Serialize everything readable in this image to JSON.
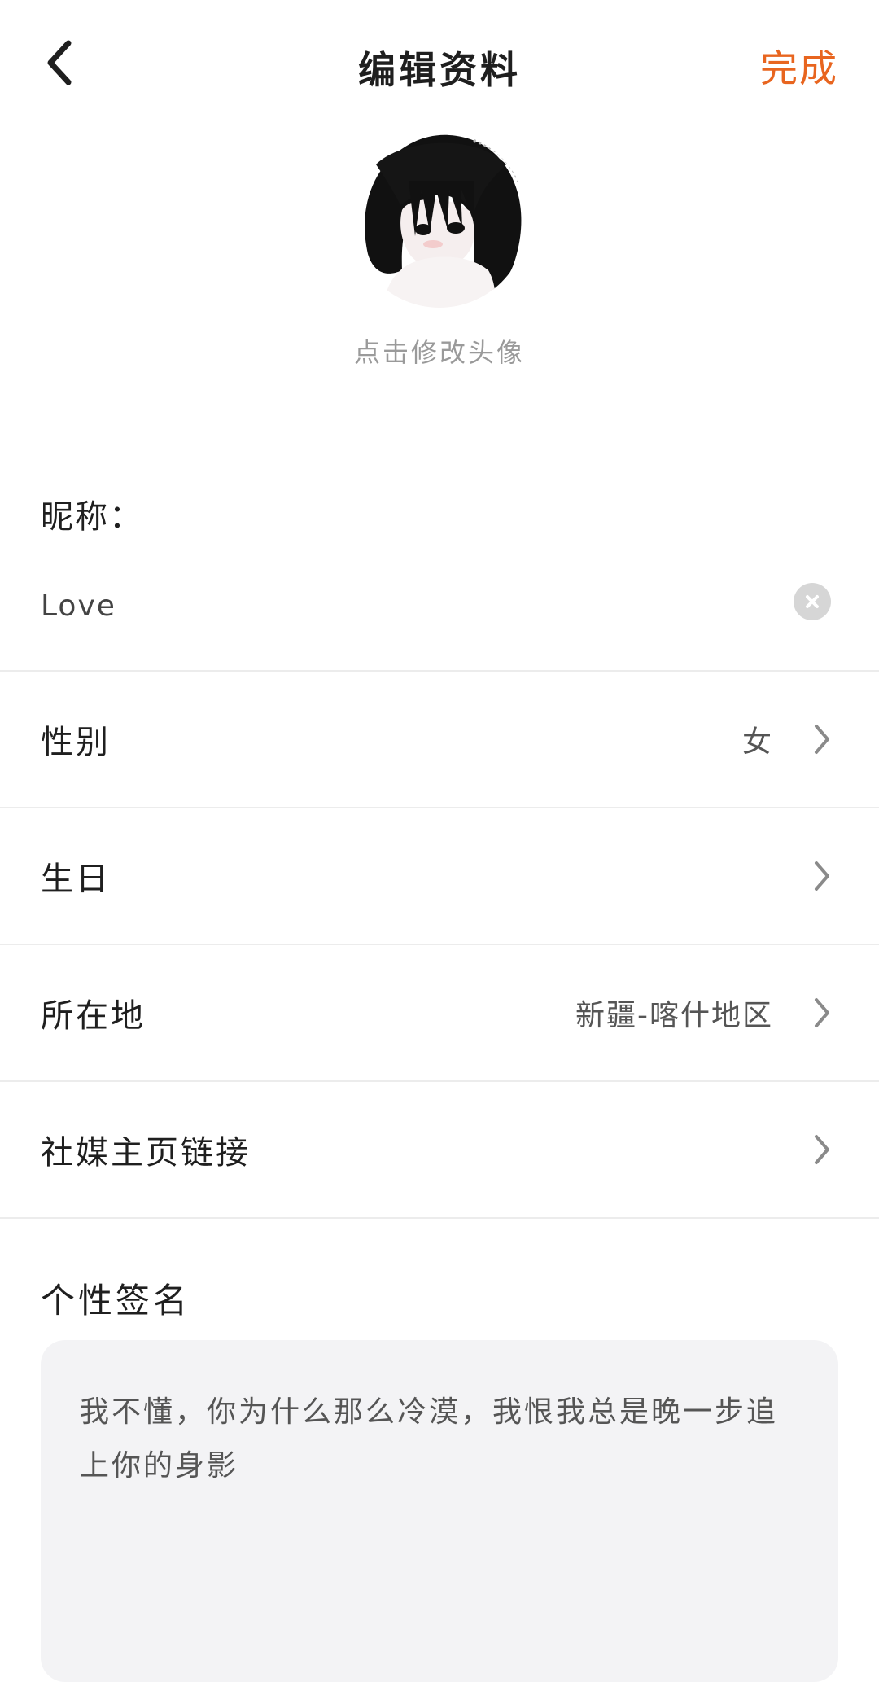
{
  "header": {
    "title": "编辑资料",
    "done_label": "完成",
    "accent_color": "#e8651f",
    "back_icon": "chevron-left-icon"
  },
  "avatar": {
    "hint": "点击修改头像"
  },
  "nickname": {
    "label": "昵称：",
    "value": "Love",
    "clear_icon": "clear-icon"
  },
  "rows": [
    {
      "label": "性别",
      "value": "女"
    },
    {
      "label": "生日",
      "value": ""
    },
    {
      "label": "所在地",
      "value": "新疆-喀什地区"
    },
    {
      "label": "社媒主页链接",
      "value": ""
    }
  ],
  "signature": {
    "label": "个性签名",
    "text": "我不懂，你为什么那么冷漠，我恨我总是晚一步追上你的身影"
  }
}
